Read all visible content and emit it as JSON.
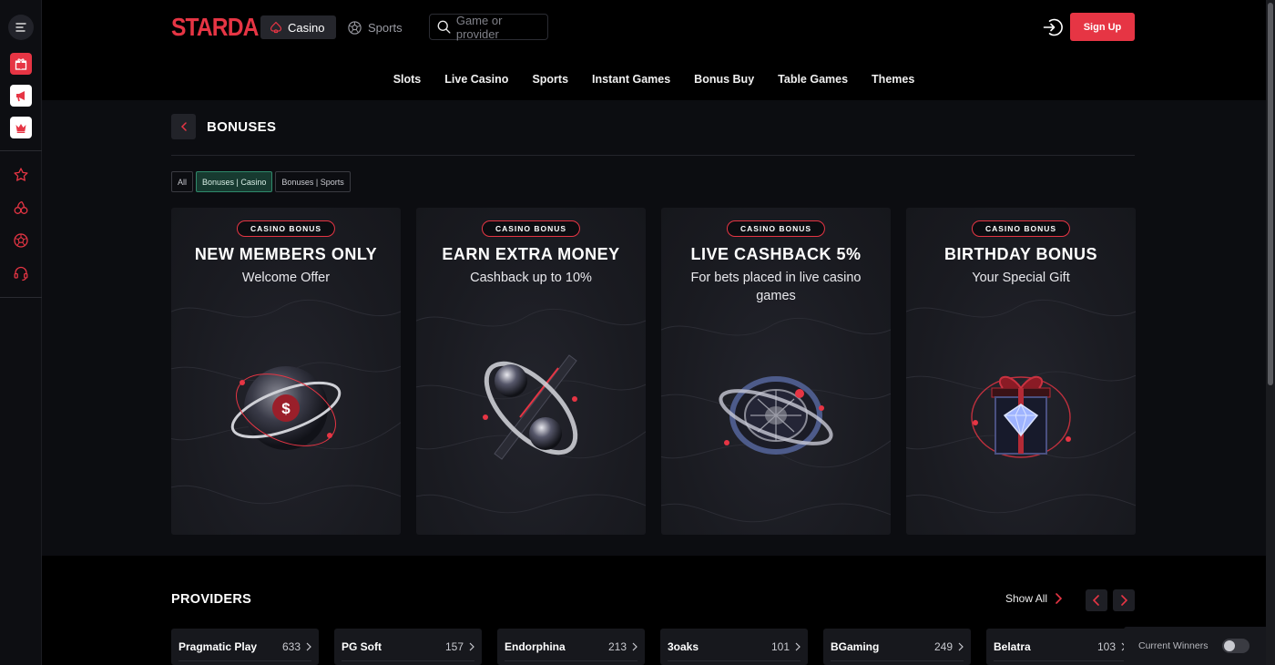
{
  "brand": {
    "logo": "STARDA",
    "accent": "#e63544"
  },
  "header": {
    "tabs": [
      {
        "label": "Casino",
        "icon": "spade-icon",
        "active": true
      },
      {
        "label": "Sports",
        "icon": "soccer-ball-icon",
        "active": false
      }
    ],
    "search": {
      "placeholder": "Game or provider"
    },
    "signup_label": "Sign Up"
  },
  "rail": {
    "icons": [
      "menu-icon",
      "gift-icon",
      "megaphone-icon",
      "crown-icon",
      "star-icon",
      "cherries-icon",
      "soccer-ball-icon",
      "headset-icon"
    ]
  },
  "nav": {
    "items": [
      "Slots",
      "Live Casino",
      "Sports",
      "Instant Games",
      "Bonus Buy",
      "Table Games",
      "Themes"
    ]
  },
  "page": {
    "title": "BONUSES",
    "filters": [
      {
        "label": "All",
        "active": false
      },
      {
        "label": "Bonuses | Casino",
        "active": true
      },
      {
        "label": "Bonuses | Sports",
        "active": false
      }
    ],
    "cards": [
      {
        "badge": "CASINO BONUS",
        "title": "NEW MEMBERS ONLY",
        "subtitle": "Welcome Offer",
        "art": "deposit-sphere-icon"
      },
      {
        "badge": "CASINO BONUS",
        "title": "EARN EXTRA MONEY",
        "subtitle": "Cashback up to 10%",
        "art": "cashback-spheres-icon"
      },
      {
        "badge": "CASINO BONUS",
        "title": "LIVE CASHBACK 5%",
        "subtitle": "For bets placed in live casino games",
        "art": "roulette-wheel-icon"
      },
      {
        "badge": "CASINO BONUS",
        "title": "BIRTHDAY BONUS",
        "subtitle": "Your Special Gift",
        "art": "gift-box-icon"
      }
    ]
  },
  "providers": {
    "title": "PROVIDERS",
    "show_all": "Show All",
    "items": [
      {
        "name": "Pragmatic Play",
        "count": "633"
      },
      {
        "name": "PG Soft",
        "count": "157"
      },
      {
        "name": "Endorphina",
        "count": "213"
      },
      {
        "name": "3oaks",
        "count": "101"
      },
      {
        "name": "BGaming",
        "count": "249"
      },
      {
        "name": "Belatra",
        "count": "103"
      }
    ]
  },
  "winners": {
    "label": "Current Winners",
    "enabled": false
  }
}
